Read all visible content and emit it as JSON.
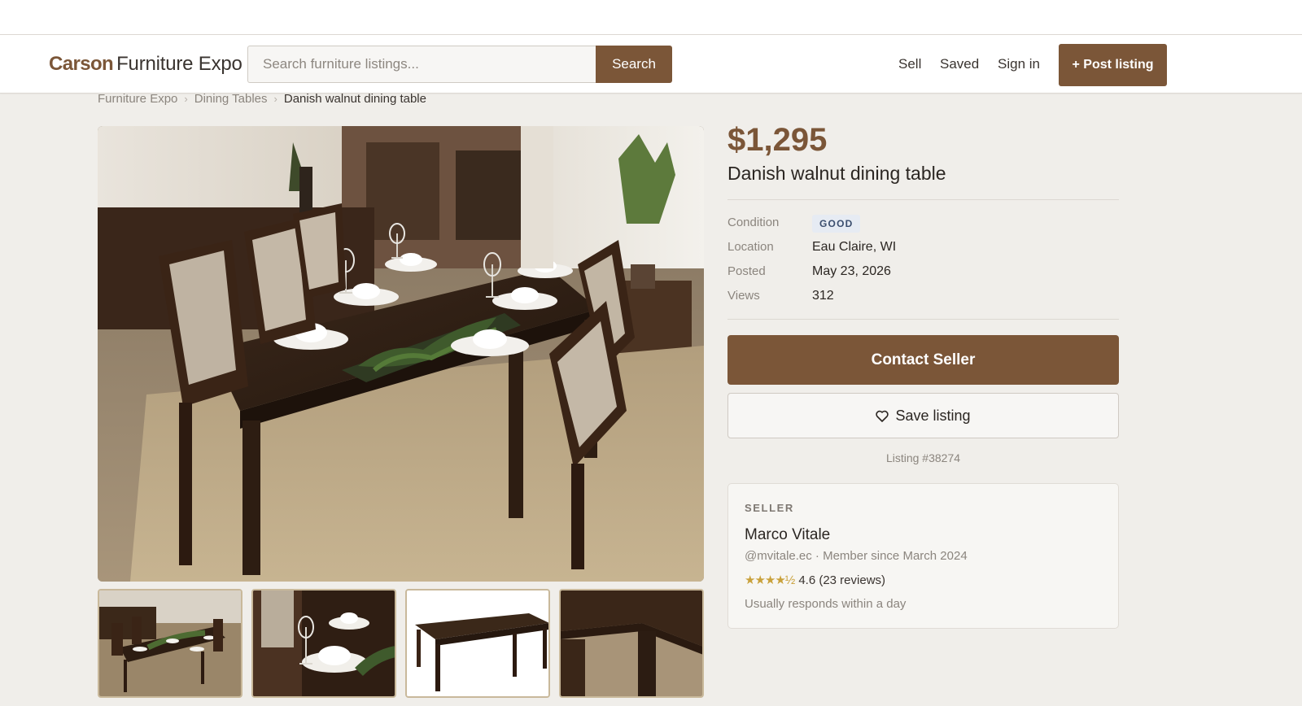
{
  "header": {
    "logo_brand": "Carson",
    "logo_rest": "Furniture Expo",
    "search_placeholder": "Search furniture listings...",
    "search_button": "Search",
    "nav": [
      "Sell",
      "Saved",
      "Sign in"
    ],
    "post_button": "+ Post listing"
  },
  "breadcrumb": [
    "Furniture Expo",
    "Dining Tables",
    "Danish walnut dining table"
  ],
  "gallery": {
    "main_image": "dining-room-table-photo",
    "thumbnails": [
      "dining-set-thumbnail",
      "place-setting-thumbnail",
      "table-only-thumbnail",
      "table-corner-thumbnail"
    ]
  },
  "listing": {
    "price": "$1,295",
    "title": "Danish walnut dining table",
    "specs": [
      {
        "label": "Condition",
        "value": "GOOD"
      },
      {
        "label": "Location",
        "value": "Eau Claire, WI"
      },
      {
        "label": "Posted",
        "value": "May 23, 2026"
      },
      {
        "label": "Views",
        "value": "312"
      }
    ],
    "contact_button": "Contact Seller",
    "save_button": "Save listing",
    "listing_id": "Listing #38274"
  },
  "seller": {
    "eyebrow": "SELLER",
    "name": "Marco Vitale",
    "meta": "@mvitale.ec · Member since March 2024",
    "stars": "★★★★½",
    "rating": "4.6 (23 reviews)",
    "response": "Usually responds within a day"
  },
  "colors": {
    "accent": "#7b5638",
    "badge_bg": "#e6ebf3",
    "star": "#c9a13b"
  }
}
